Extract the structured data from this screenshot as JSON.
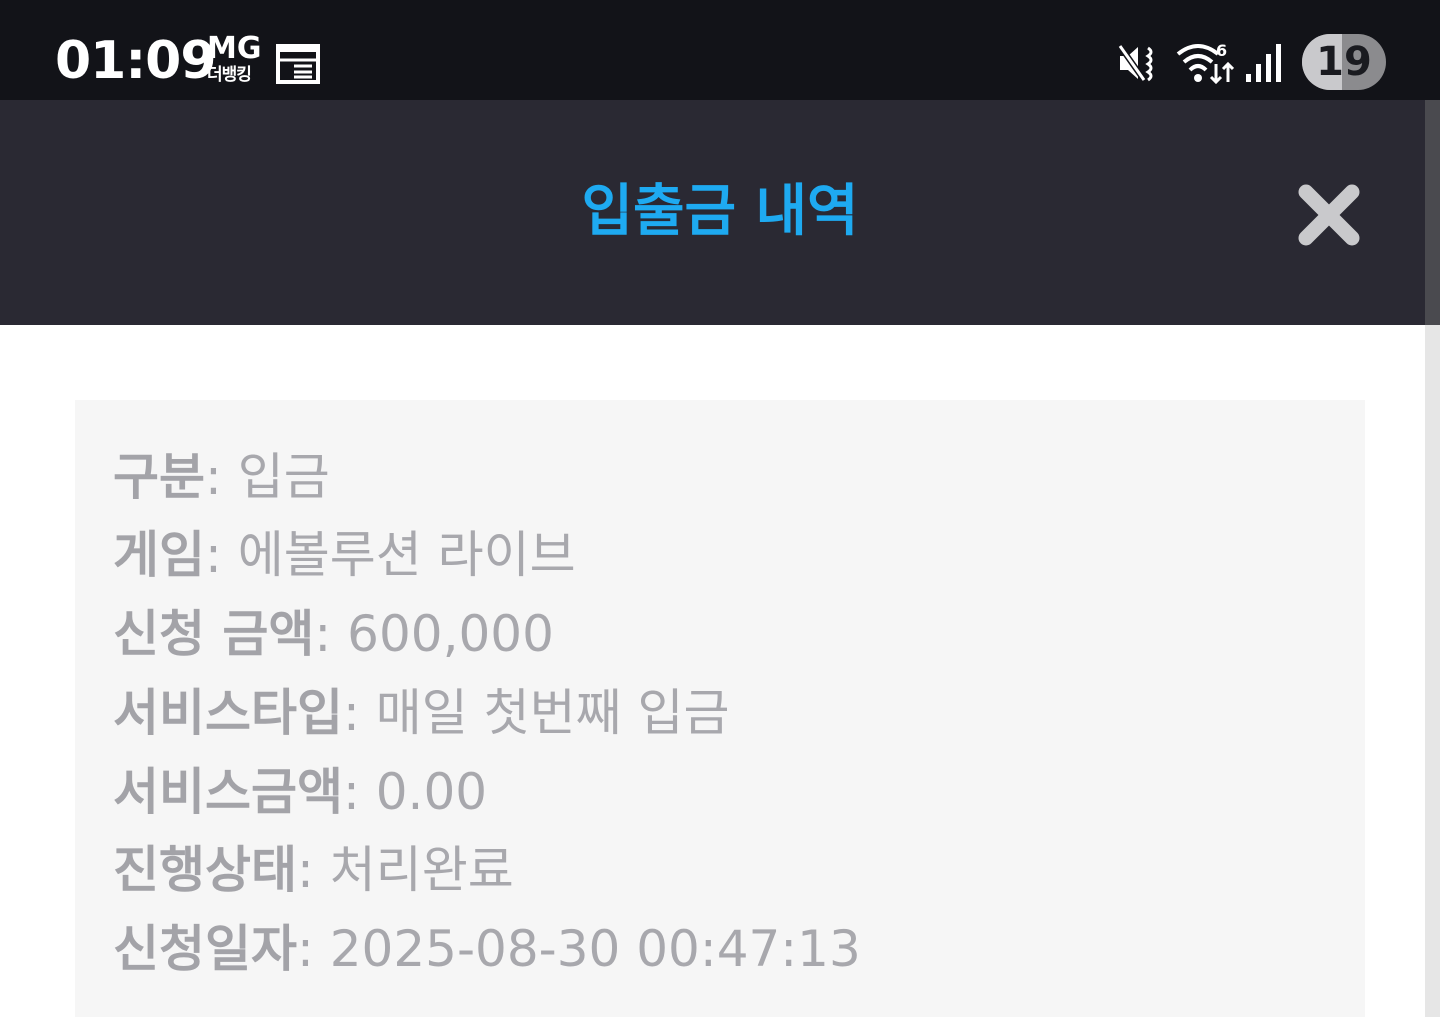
{
  "status_bar": {
    "time": "01:09",
    "carrier_top": "MG",
    "carrier_bottom": "더뱅킹",
    "battery_level": "19",
    "icons": [
      "calendar-icon",
      "mute-icon",
      "wifi-icon",
      "signal-icon"
    ]
  },
  "header": {
    "title": "입출금 내역",
    "close_icon": "close-icon",
    "title_color": "#1eaaf1"
  },
  "details": [
    {
      "label": "구분",
      "separator": ": ",
      "value": "입금"
    },
    {
      "label": "게임",
      "separator": ": ",
      "value": "에볼루션 라이브"
    },
    {
      "label": "신청 금액",
      "separator": ": ",
      "value": "600,000"
    },
    {
      "label": "서비스타입",
      "separator": ": ",
      "value": "매일 첫번째 입금"
    },
    {
      "label": "서비스금액",
      "separator": ": ",
      "value": "0.00"
    },
    {
      "label": "진행상태",
      "separator": ": ",
      "value": "처리완료"
    },
    {
      "label": "신청일자",
      "separator": ": ",
      "value": "2025-08-30 00:47:13"
    }
  ]
}
